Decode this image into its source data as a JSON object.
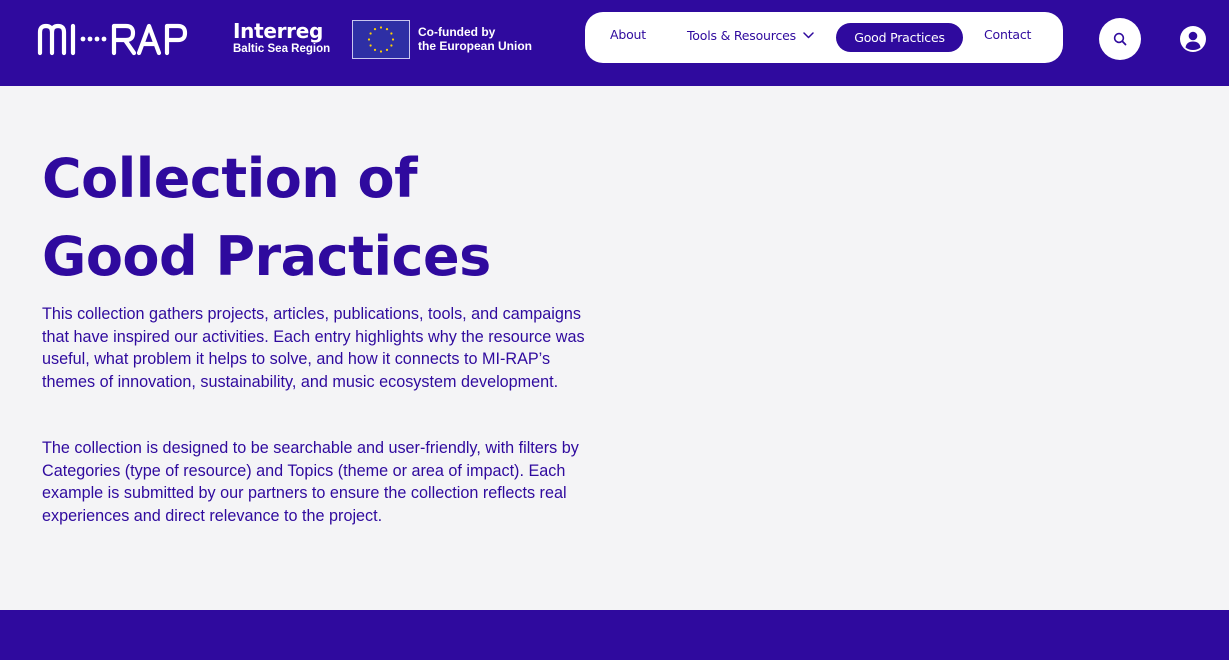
{
  "brand": {
    "logo": "MI-RAP",
    "interreg_title": "Interreg",
    "interreg_subtitle": "Baltic Sea Region",
    "eu_line1": "Co-funded by",
    "eu_line2": "the European Union",
    "accent": "#2f0a9e",
    "background": "#f4f4f6"
  },
  "nav": {
    "items": [
      {
        "label": "About"
      },
      {
        "label": "Tools & Resources",
        "icon": "chevron-down-icon"
      },
      {
        "label": "Good Practices",
        "active": true
      },
      {
        "label": "Contact"
      }
    ],
    "search_icon": "search-icon",
    "account_icon": "user-icon"
  },
  "hero": {
    "title_line1": "Collection of",
    "title_line2": "Good Practices",
    "paragraph1": "This collection gathers projects, articles, publications, tools, and campaigns that have inspired our activities. Each entry highlights why the resource was useful, what problem it helps to solve, and how it connects to MI-RAP’s themes of innovation, sustainability, and music ecosystem development.",
    "paragraph2": "The collection is designed to be searchable and user-friendly, with filters by Categories (type of resource) and Topics (theme or area of impact). Each example is submitted by our partners to ensure the collection reflects real experiences and direct relevance to the project."
  }
}
